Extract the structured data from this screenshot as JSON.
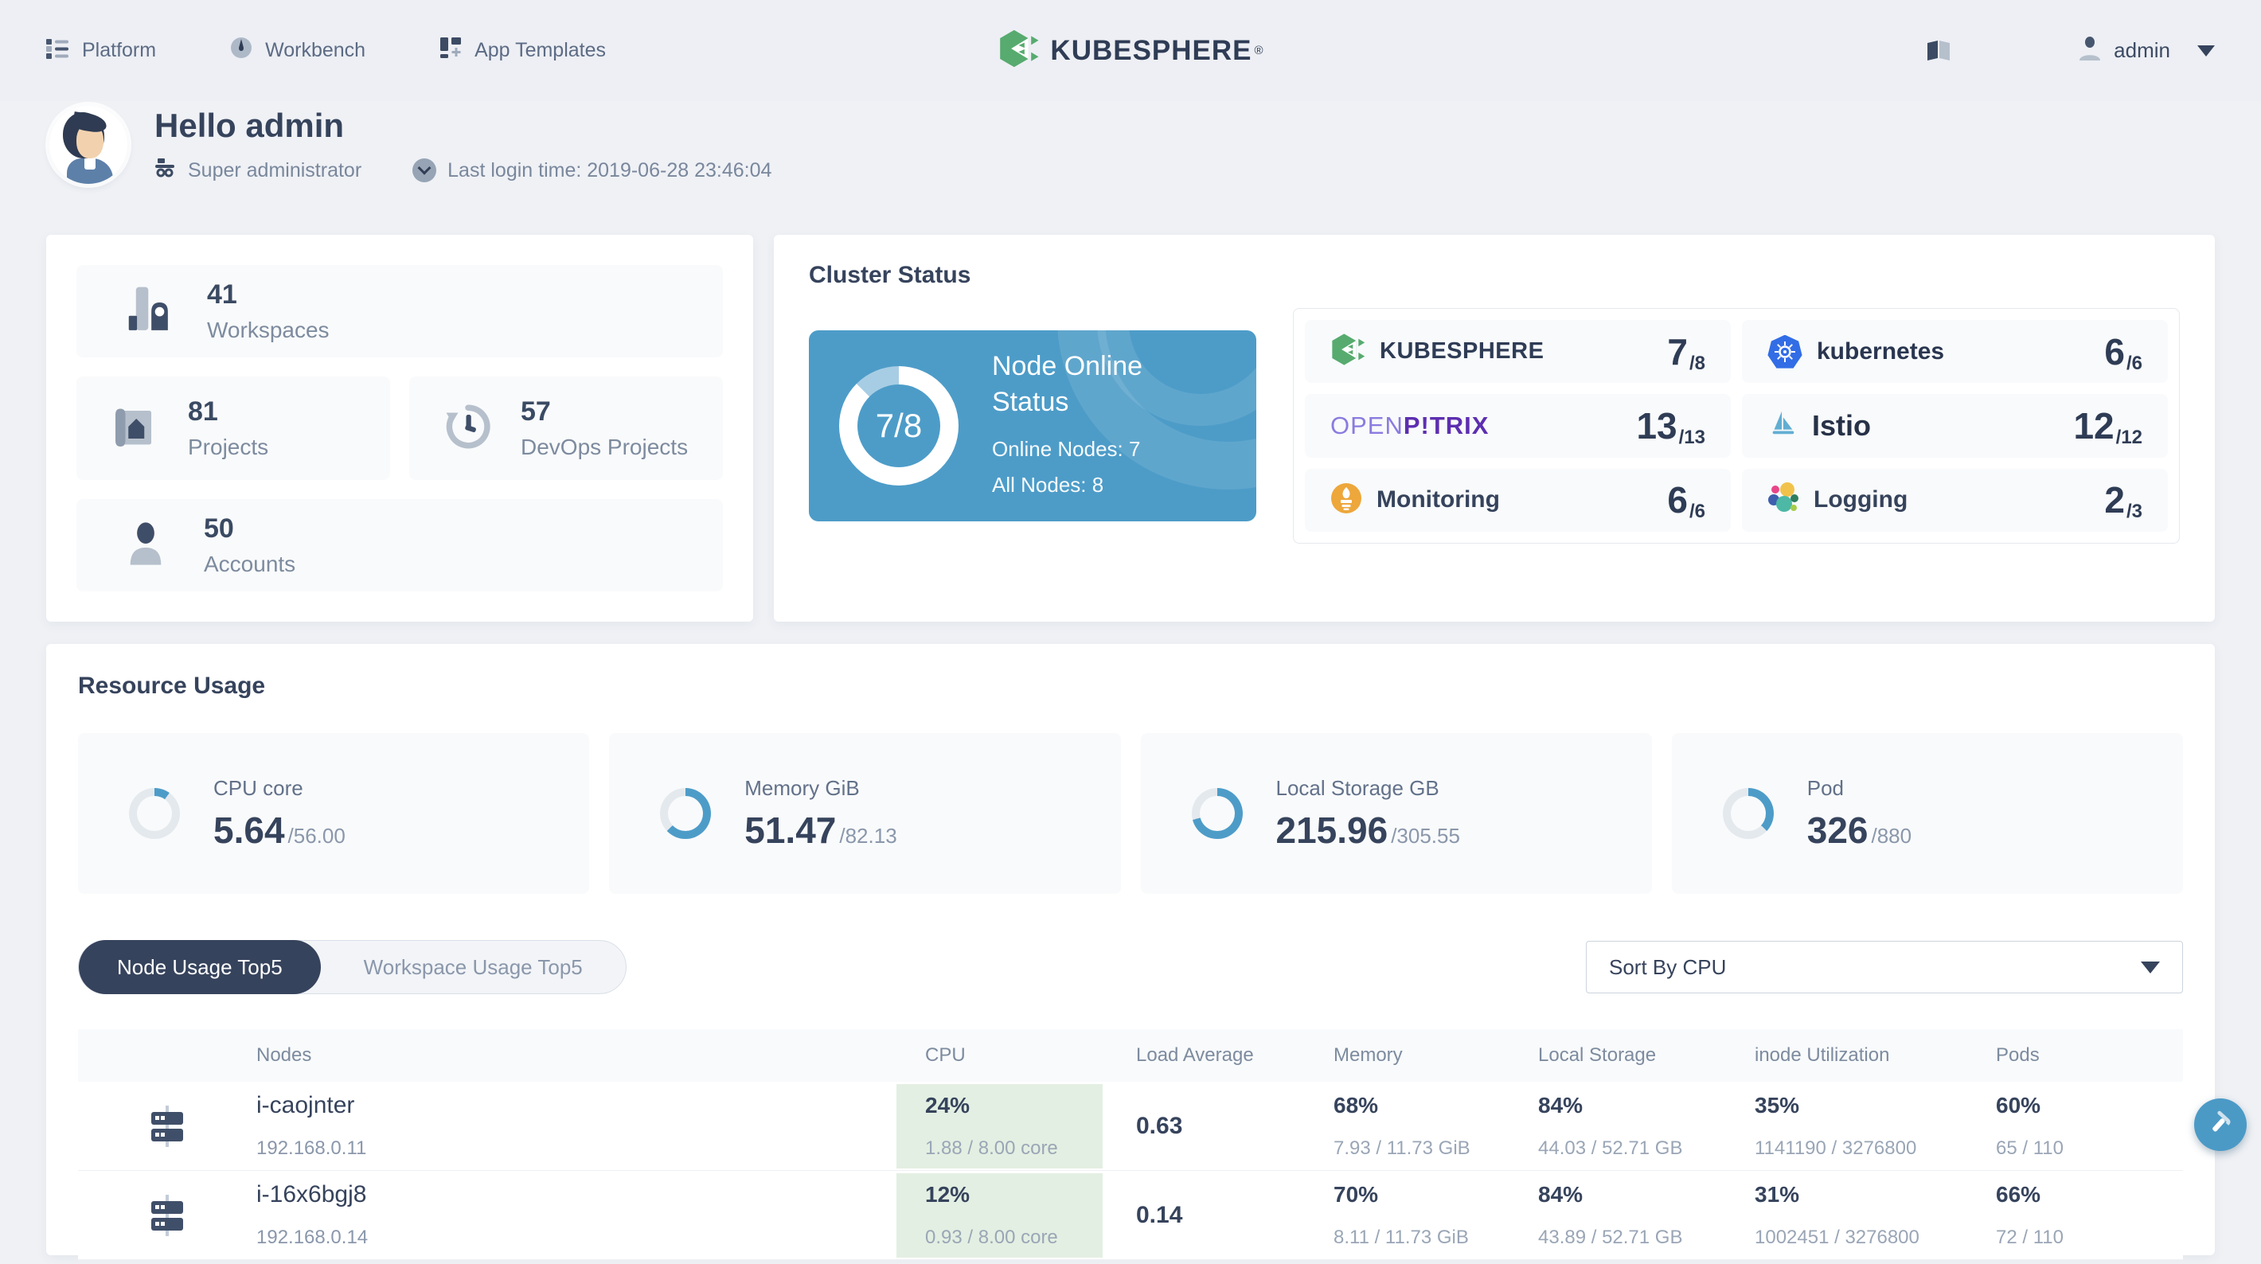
{
  "colors": {
    "accent_blue": "#4d9cc8",
    "donut_track": "#e4e9ee",
    "node_card_bg": "#4d9cc8",
    "offline_segment": "#a7cde4",
    "cpu_cell_green": "#e3efe2",
    "navy_text": "#36435c",
    "active_tab_bg": "#36435c",
    "kubesphere_green": "#57ab6f"
  },
  "nav": {
    "items": [
      {
        "label": "Platform"
      },
      {
        "label": "Workbench"
      },
      {
        "label": "App Templates"
      }
    ],
    "brand": "KUBESPHERE",
    "brand_reg": "®",
    "user": "admin"
  },
  "greeting": {
    "title": "Hello admin",
    "role": "Super administrator",
    "last_login": "Last login time: 2019-06-28 23:46:04"
  },
  "stats": {
    "items": [
      {
        "value": "41",
        "label": "Workspaces"
      },
      {
        "value": "81",
        "label": "Projects"
      },
      {
        "value": "57",
        "label": "DevOps Projects"
      },
      {
        "value": "50",
        "label": "Accounts"
      }
    ]
  },
  "cluster": {
    "title": "Cluster Status",
    "node_status": {
      "display": "7/8",
      "pct": 87.5,
      "heading": "Node Online Status",
      "online": "Online Nodes: 7",
      "all": "All Nodes: 8"
    },
    "components": [
      {
        "name": "KUBESPHERE",
        "num": "7",
        "den": "/8"
      },
      {
        "name": "kubernetes",
        "num": "6",
        "den": "/6"
      },
      {
        "name_a": "OPEN",
        "name_b": "P!TRIX",
        "num": "13",
        "den": "/13"
      },
      {
        "name": "Istio",
        "num": "12",
        "den": "/12"
      },
      {
        "name": "Monitoring",
        "num": "6",
        "den": "/6"
      },
      {
        "name": "Logging",
        "num": "2",
        "den": "/3"
      }
    ]
  },
  "resources": {
    "title": "Resource Usage",
    "cards": [
      {
        "label": "CPU core",
        "used": "5.64",
        "den": "/56.00",
        "pct": 10
      },
      {
        "label": "Memory GiB",
        "used": "51.47",
        "den": "/82.13",
        "pct": 63
      },
      {
        "label": "Local Storage GB",
        "used": "215.96",
        "den": "/305.55",
        "pct": 71
      },
      {
        "label": "Pod",
        "used": "326",
        "den": "/880",
        "pct": 37
      }
    ]
  },
  "usage": {
    "tabs": [
      {
        "label": "Node Usage Top5",
        "active": true
      },
      {
        "label": "Workspace Usage Top5",
        "active": false
      }
    ],
    "sort_label": "Sort By CPU",
    "columns": [
      "Nodes",
      "CPU",
      "Load Average",
      "Memory",
      "Local Storage",
      "inode Utilization",
      "Pods"
    ],
    "rows": [
      {
        "name": "i-caojnter",
        "ip": "192.168.0.11",
        "cpu_pct": "24%",
        "cpu_detail": "1.88 / 8.00 core",
        "load": "0.63",
        "mem_pct": "68%",
        "mem_detail": "7.93 / 11.73 GiB",
        "storage_pct": "84%",
        "storage_detail": "44.03 / 52.71 GB",
        "inode_pct": "35%",
        "inode_detail": "1141190 / 3276800",
        "pods_pct": "60%",
        "pods_detail": "65 / 110"
      },
      {
        "name": "i-16x6bgj8",
        "ip": "192.168.0.14",
        "cpu_pct": "12%",
        "cpu_detail": "0.93 / 8.00 core",
        "load": "0.14",
        "mem_pct": "70%",
        "mem_detail": "8.11 / 11.73 GiB",
        "storage_pct": "84%",
        "storage_detail": "43.89 / 52.71 GB",
        "inode_pct": "31%",
        "inode_detail": "1002451 / 3276800",
        "pods_pct": "66%",
        "pods_detail": "72 / 110"
      }
    ]
  }
}
